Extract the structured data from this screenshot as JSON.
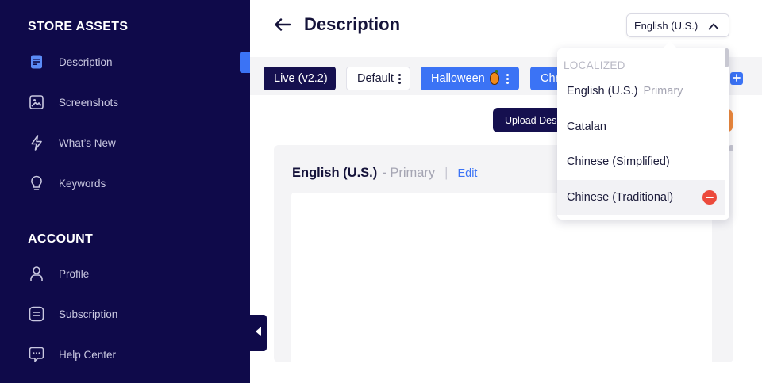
{
  "sidebar": {
    "store_assets_title": "STORE ASSETS",
    "store_items": [
      {
        "label": "Description"
      },
      {
        "label": "Screenshots"
      },
      {
        "label": "What’s New"
      },
      {
        "label": "Keywords"
      }
    ],
    "account_title": "ACCOUNT",
    "account_items": [
      {
        "label": "Profile"
      },
      {
        "label": "Subscription"
      },
      {
        "label": "Help Center"
      }
    ]
  },
  "header": {
    "title": "Description",
    "language_select": {
      "value": "English (U.S.)"
    }
  },
  "tabs": [
    {
      "label": "Live (v2.2)"
    },
    {
      "label": "Default"
    },
    {
      "label": "Halloween"
    },
    {
      "label": "Chr"
    }
  ],
  "toolbar": {
    "upload_label": "Upload Desc"
  },
  "card": {
    "language": "English (U.S.)",
    "primary_suffix": "- Primary",
    "separator": "|",
    "edit_label": "Edit"
  },
  "dropdown": {
    "header": "LOCALIZED",
    "items": [
      {
        "label": "English (U.S.)",
        "tag": "Primary"
      },
      {
        "label": "Catalan"
      },
      {
        "label": "Chinese (Simplified)"
      },
      {
        "label": "Chinese (Traditional)"
      }
    ]
  },
  "colors": {
    "sidebar_bg": "#0f0a4a",
    "accent_blue": "#3b73f5",
    "dark_tab": "#15104f",
    "remove_red": "#ec4a3c",
    "orange": "#f08a3c"
  }
}
